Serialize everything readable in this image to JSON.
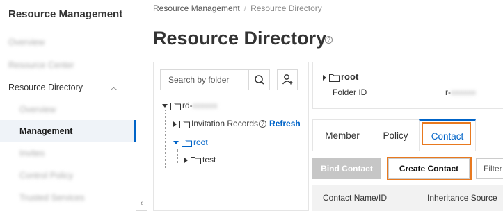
{
  "sidebar": {
    "title": "Resource Management",
    "items": [
      {
        "label": "Overview",
        "blurred": true
      },
      {
        "label": "Resource Center",
        "blurred": true
      },
      {
        "label": "Resource Directory",
        "blurred": false
      },
      {
        "label": "Overview",
        "blurred": true
      },
      {
        "label": "Management",
        "blurred": false
      },
      {
        "label": "Invites",
        "blurred": true
      },
      {
        "label": "Control Policy",
        "blurred": true
      },
      {
        "label": "Trusted Services",
        "blurred": true
      }
    ],
    "collapse_glyph": "‹",
    "expand_glyph": "︿"
  },
  "breadcrumb": {
    "items": [
      "Resource Management",
      "Resource Directory"
    ],
    "separator": "/"
  },
  "page": {
    "title": "Resource Directory",
    "help_glyph": "?"
  },
  "tree": {
    "search_placeholder": "Search by folder",
    "root_label": "rd-",
    "root_id_blurred": "xxxxxx",
    "invitation_label": "Invitation Records",
    "refresh_label": "Refresh",
    "root_folder": "root",
    "child_folder": "test",
    "help_glyph": "?"
  },
  "detail": {
    "name": "root",
    "folder_id_label": "Folder ID",
    "folder_id_prefix": "r-",
    "folder_id_blurred": "xxxxxx"
  },
  "tabs": [
    {
      "label": "Member",
      "active": false
    },
    {
      "label": "Policy",
      "active": false
    },
    {
      "label": "Contact",
      "active": true
    }
  ],
  "toolbar": {
    "bind_contact": "Bind Contact",
    "create_contact": "Create Contact",
    "filter": "Filter"
  },
  "table": {
    "columns": [
      "Contact Name/ID",
      "Inheritance Source"
    ]
  },
  "colors": {
    "accent": "#0064c8",
    "highlight": "#e8791f",
    "disabled": "#c6c6c6"
  }
}
